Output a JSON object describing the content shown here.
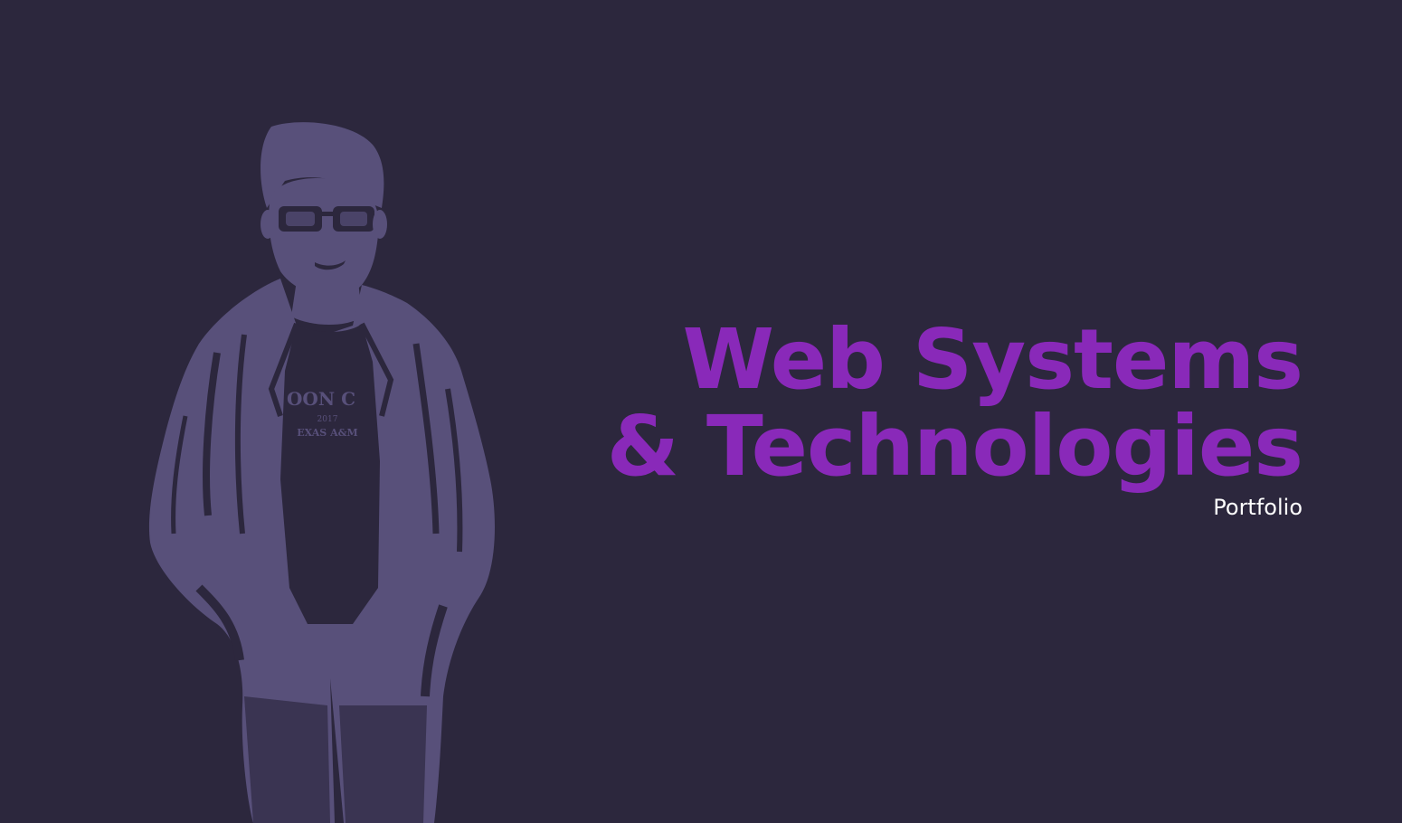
{
  "hero": {
    "title_line1": "Web Systems",
    "title_line2": "& Technologies",
    "subtitle": "Portfolio",
    "title_color": "#8929b9",
    "subtitle_color": "#ffffff"
  },
  "portrait": {
    "description_icon": "person-portrait-icon",
    "shirt_text_line1": "OON C",
    "shirt_text_line2": "2017",
    "shirt_text_line3": "EXAS A&M"
  },
  "theme": {
    "background": "#2c273d",
    "portrait_tone": "#58507a"
  }
}
